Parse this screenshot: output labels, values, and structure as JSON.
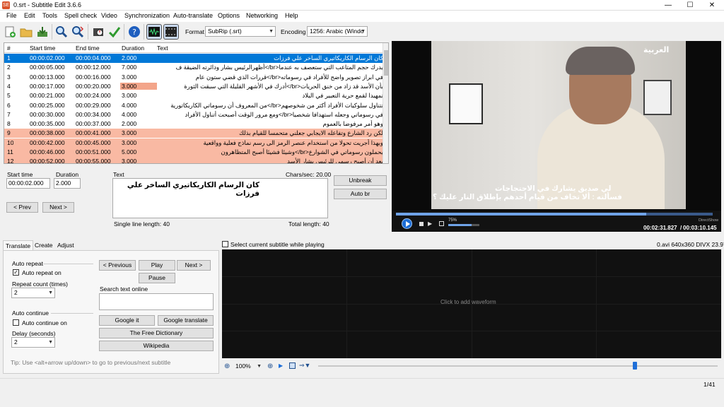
{
  "window": {
    "title": "0.srt - Subtitle Edit 3.6.6",
    "app_icon": "SE"
  },
  "menu": [
    "File",
    "Edit",
    "Tools",
    "Spell check",
    "Video",
    "Synchronization",
    "Auto-translate",
    "Options",
    "Networking",
    "Help"
  ],
  "toolbar": {
    "format_label": "Format",
    "format_value": "SubRip (.srt)",
    "encoding_label": "Encoding",
    "encoding_value": "1256: Arabic (Windo"
  },
  "grid": {
    "headers": [
      "#",
      "Start time",
      "End time",
      "Duration",
      "Text"
    ],
    "rows": [
      {
        "n": "1",
        "start": "00:00:02.000",
        "end": "00:00:04.000",
        "dur": "2.000",
        "text": "كان الرسام الكاريكاتيري الساخر علي فرزات"
      },
      {
        "n": "2",
        "start": "00:00:05.000",
        "end": "00:00:12.000",
        "dur": "7.000",
        "text": "يدرك حجم المتاعب التي ستعصف به عندما<br/>أظهرالرئيس بشار ودائرته الضيقة ف"
      },
      {
        "n": "3",
        "start": "00:00:13.000",
        "end": "00:00:16.000",
        "dur": "3.000",
        "text": "في ابراز تصوير واضح للأفراد في رسوماته<br/>قررات الذي قضي ستون عام"
      },
      {
        "n": "4",
        "start": "00:00:17.000",
        "end": "00:00:20.000",
        "dur": "3.000",
        "text": "بأن الأسد قد زاد من خنق الحريات<br/>أدرك في الأشهر القليلة التي سبقت الثورة"
      },
      {
        "n": "5",
        "start": "00:00:21.000",
        "end": "00:00:24.000",
        "dur": "3.000",
        "text": "تمهيدا لقمع حرية التعبير في البلاد"
      },
      {
        "n": "6",
        "start": "00:00:25.000",
        "end": "00:00:29.000",
        "dur": "4.000",
        "text": "تتناول سلوكيات الأفراد أكثر من شخوصهم<br/>من المعروف أن رسوماتي الكاريكاتورية"
      },
      {
        "n": "7",
        "start": "00:00:30.000",
        "end": "00:00:34.000",
        "dur": "4.000",
        "text": "في رسوماتي وجعله استهدافا شخصيا<br/>ومع مرور الوقت أصبحت أتناول الأفراد"
      },
      {
        "n": "8",
        "start": "00:00:35.000",
        "end": "00:00:37.000",
        "dur": "2.000",
        "text": "وهو أمر مرفوضا بالعموم"
      },
      {
        "n": "9",
        "start": "00:00:38.000",
        "end": "00:00:41.000",
        "dur": "3.000",
        "text": "لكن رد الشارع وتفاعله الايجابي جعلني متحمسا للقيام بذلك"
      },
      {
        "n": "10",
        "start": "00:00:42.000",
        "end": "00:00:45.000",
        "dur": "3.000",
        "text": "وبهذا أجريت تحولا من استخدام عنصر الرمز الى رسم نماذج فعلية وواقعية"
      },
      {
        "n": "11",
        "start": "00:00:46.000",
        "end": "00:00:51.000",
        "dur": "5.000",
        "text": "يحملون رسوماتي في الشوارع<br/>وشيئا فشيئا أصبح المتظاهرون"
      },
      {
        "n": "12",
        "start": "00:00:52.000",
        "end": "00:00:55.000",
        "dur": "3.000",
        "text": "بعد أن أصبح رسمي للرئيس بشار الأسد"
      }
    ]
  },
  "editor": {
    "start_time_label": "Start time",
    "start_time_value": "00:00:02.000",
    "duration_label": "Duration",
    "duration_value": "2.000",
    "text_label": "Text",
    "chars_sec": "Chars/sec: 20.00",
    "text_value": "كان الرسام الكاريكاتيري الساخر علي فرزات",
    "single_line_length": "Single line length: 40",
    "total_length": "Total length: 40",
    "prev": "< Prev",
    "next": "Next >",
    "unbreak": "Unbreak",
    "auto_br": "Auto br"
  },
  "video": {
    "subtitle_line1": "لي صديق يشارك في الاحتجاجات",
    "subtitle_line2": "فسألته : ألا تخاف من قيام أحدهم بإطلاق النار عليك ؟",
    "channel_logo": "العربية",
    "time_current": "00:02:31.827",
    "time_total": "00:03:10.145",
    "volume": "75%",
    "renderer": "DirectShow",
    "seek_fraction": 0.79
  },
  "tabs": [
    "Translate",
    "Create",
    "Adjust"
  ],
  "translate": {
    "auto_repeat_title": "Auto repeat",
    "auto_repeat_on": "Auto repeat on",
    "repeat_count_label": "Repeat count (times)",
    "repeat_count": "2",
    "auto_continue_title": "Auto continue",
    "auto_continue_on": "Auto continue on",
    "delay_label": "Delay (seconds)",
    "delay": "2",
    "previous": "< Previous",
    "play": "Play",
    "next": "Next >",
    "pause": "Pause",
    "search_label": "Search text online",
    "google_it": "Google it",
    "google_translate": "Google translate",
    "free_dictionary": "The Free Dictionary",
    "wikipedia": "Wikipedia",
    "tip": "Tip: Use <alt+arrow up/down> to go to previous/next subtitle"
  },
  "waveform": {
    "select_label": "Select current subtitle while playing",
    "info": "0.avi 640x360 DIVX 23.976",
    "placeholder": "Click to add waveform",
    "zoom": "100%"
  },
  "status": {
    "position": "1/41"
  }
}
